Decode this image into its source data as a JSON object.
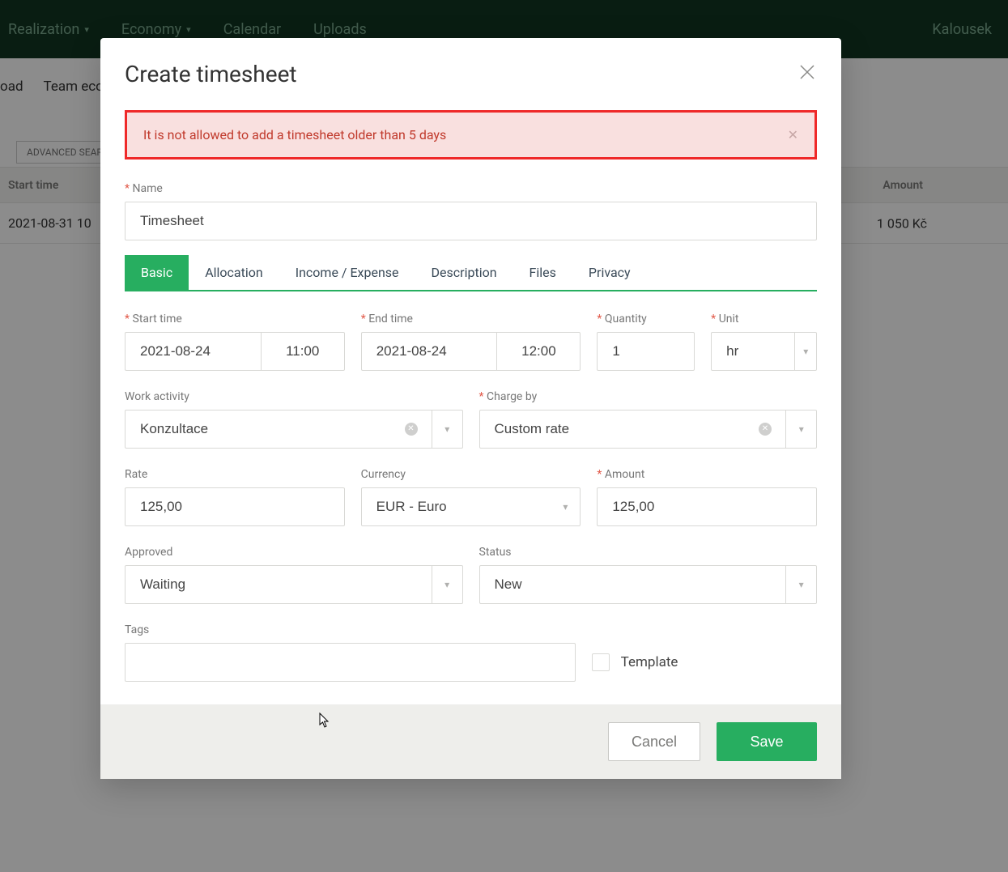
{
  "bg": {
    "nav": {
      "realization": "Realization",
      "economy": "Economy",
      "calendar": "Calendar",
      "uploads": "Uploads"
    },
    "user": "Kalousek",
    "subnav": {
      "item1": "oad",
      "item2": "Team econ"
    },
    "filter_button": "ADVANCED SEAR",
    "table": {
      "header_start": "Start time",
      "header_amount": "Amount",
      "row1_start": "2021-08-31 10",
      "row1_amount": "1 050 Kč"
    }
  },
  "modal": {
    "title": "Create timesheet",
    "alert": "It is not allowed to add a timesheet older than 5 days",
    "labels": {
      "name": "Name",
      "start_time": "Start time",
      "end_time": "End time",
      "quantity": "Quantity",
      "unit": "Unit",
      "work_activity": "Work activity",
      "charge_by": "Charge by",
      "rate": "Rate",
      "currency": "Currency",
      "amount": "Amount",
      "approved": "Approved",
      "status": "Status",
      "tags": "Tags",
      "template": "Template"
    },
    "values": {
      "name": "Timesheet",
      "start_date": "2021-08-24",
      "start_time": "11:00",
      "end_date": "2021-08-24",
      "end_time": "12:00",
      "quantity": "1",
      "unit": "hr",
      "work_activity": "Konzultace",
      "charge_by": "Custom rate",
      "rate": "125,00",
      "currency": "EUR - Euro",
      "amount": "125,00",
      "approved": "Waiting",
      "status": "New",
      "tags": ""
    },
    "tabs": [
      "Basic",
      "Allocation",
      "Income / Expense",
      "Description",
      "Files",
      "Privacy"
    ],
    "buttons": {
      "cancel": "Cancel",
      "save": "Save"
    }
  }
}
